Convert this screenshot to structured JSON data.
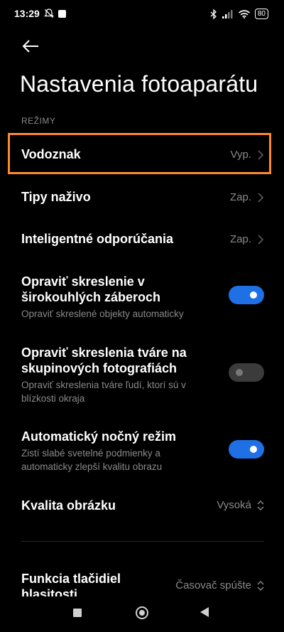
{
  "status_bar": {
    "time": "13:29",
    "battery": "80"
  },
  "header": {
    "title": "Nastavenia fotoaparátu"
  },
  "section": {
    "label": "REŽIMY"
  },
  "rows": {
    "watermark": {
      "title": "Vodoznak",
      "value": "Vyp."
    },
    "live_tips": {
      "title": "Tipy naživo",
      "value": "Zap."
    },
    "smart_suggestions": {
      "title": "Inteligentné odporúčania",
      "value": "Zap."
    },
    "wide_distortion": {
      "title": "Opraviť skreslenie v širokouhlých záberoch",
      "subtitle": "Opraviť skreslené objekty automaticky",
      "enabled": true
    },
    "face_distortion": {
      "title": "Opraviť skreslenia tváre na skupinových fotografiách",
      "subtitle": "Opraviť skreslenia tváre ľudí, ktorí sú v blízkosti okraja",
      "enabled": false
    },
    "night_mode": {
      "title": "Automatický nočný režim",
      "subtitle": "Zistí slabé svetelné podmienky a automaticky zlepší kvalitu obrazu",
      "enabled": true
    },
    "image_quality": {
      "title": "Kvalita obrázku",
      "value": "Vysoká"
    },
    "volume_buttons": {
      "title": "Funkcia tlačidiel hlasitosti",
      "value": "Časovač spúšte"
    }
  },
  "colors": {
    "accent": "#1f6fe5",
    "highlight": "#ff8a2a"
  }
}
